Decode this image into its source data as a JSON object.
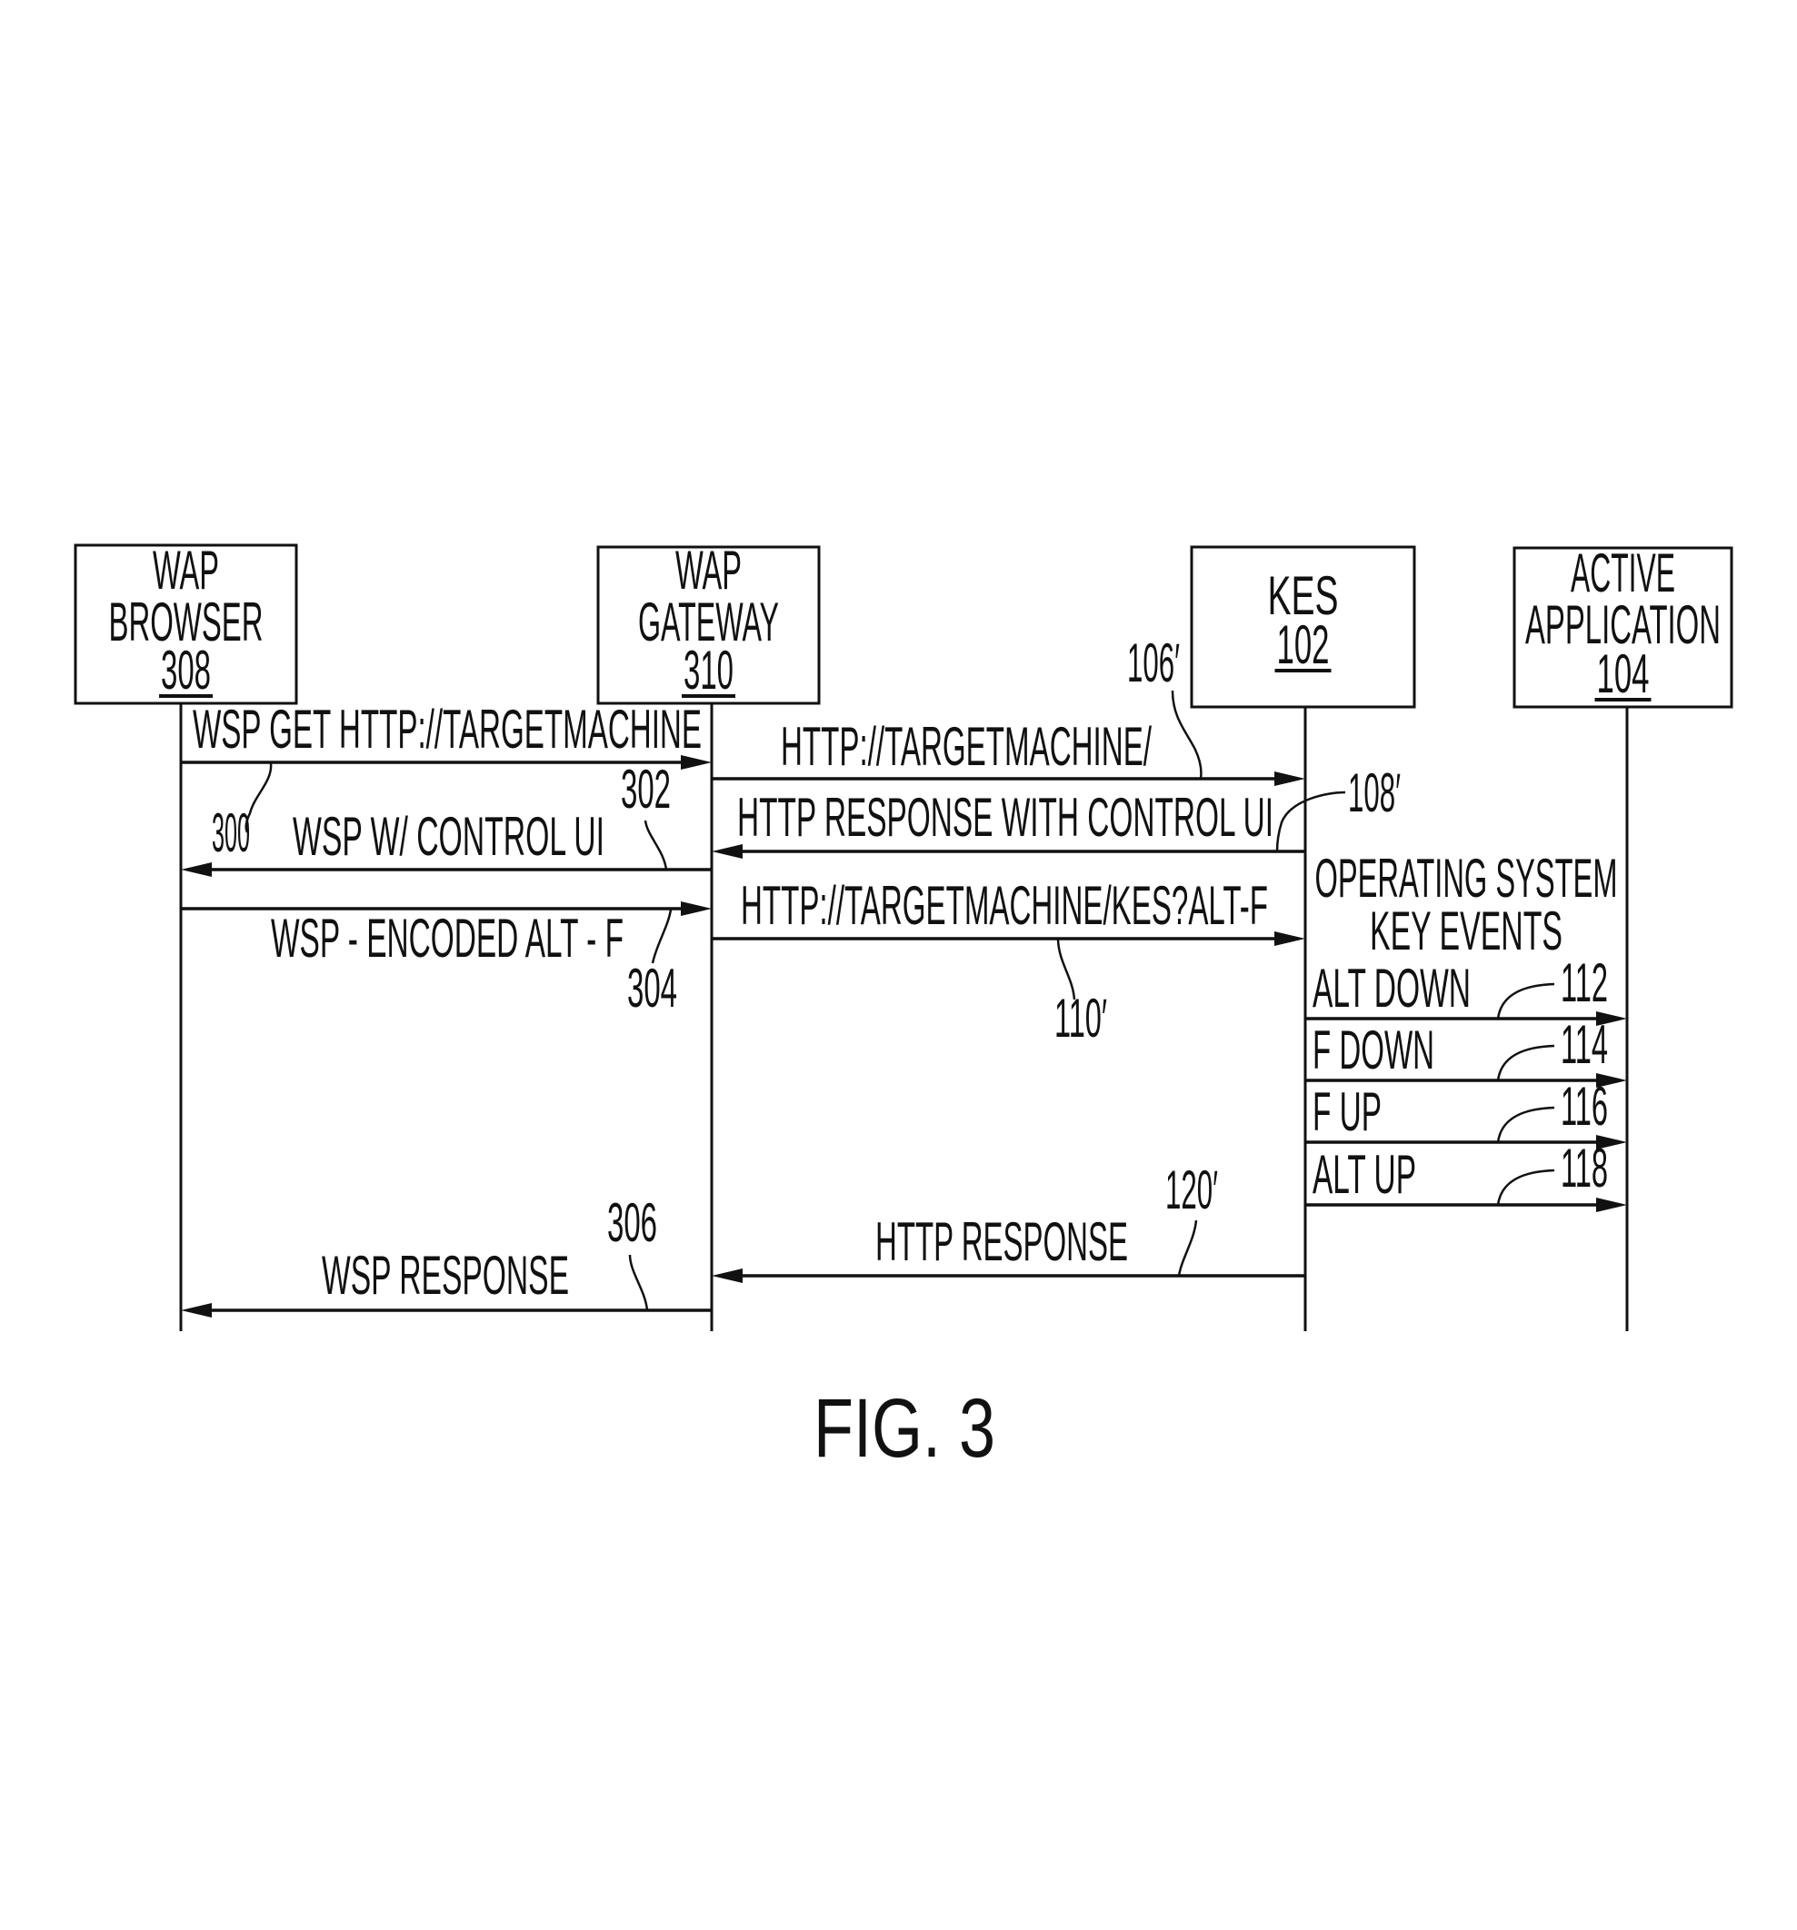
{
  "figure": {
    "caption": "FIG. 3"
  },
  "participants": [
    {
      "id": "browser",
      "lines": [
        "WAP",
        "BROWSER"
      ],
      "ref": "308"
    },
    {
      "id": "gateway",
      "lines": [
        "WAP",
        "GATEWAY"
      ],
      "ref": "310"
    },
    {
      "id": "kes",
      "lines": [
        "KES"
      ],
      "ref": "102"
    },
    {
      "id": "app",
      "lines": [
        "ACTIVE",
        "APPLICATION"
      ],
      "ref": "104"
    }
  ],
  "messages": [
    {
      "from": "browser",
      "to": "gateway",
      "label": "WSP GET HTTP://TARGETMACHINE",
      "ref": "300"
    },
    {
      "from": "gateway",
      "to": "kes",
      "label": "HTTP://TARGETMACHINE/",
      "ref": "106′"
    },
    {
      "from": "kes",
      "to": "gateway",
      "label": "HTTP RESPONSE WITH CONTROL UI",
      "ref": "108′"
    },
    {
      "from": "gateway",
      "to": "browser",
      "label": "WSP W/ CONTROL UI",
      "ref": "302"
    },
    {
      "from": "browser",
      "to": "gateway",
      "label": "WSP - ENCODED ALT - F",
      "ref": "304"
    },
    {
      "from": "gateway",
      "to": "kes",
      "label": "HTTP://TARGETMACHINE/KES?ALT-F",
      "ref": "110′"
    },
    {
      "from": "kes",
      "to": "app",
      "label": "ALT DOWN",
      "ref": "112"
    },
    {
      "from": "kes",
      "to": "app",
      "label": "F DOWN",
      "ref": "114"
    },
    {
      "from": "kes",
      "to": "app",
      "label": "F UP",
      "ref": "116"
    },
    {
      "from": "kes",
      "to": "app",
      "label": "ALT UP",
      "ref": "118"
    },
    {
      "from": "kes",
      "to": "gateway",
      "label": "HTTP RESPONSE",
      "ref": "120′"
    },
    {
      "from": "gateway",
      "to": "browser",
      "label": "WSP RESPONSE",
      "ref": "306"
    }
  ],
  "notes": [
    {
      "id": "os-key-events",
      "lines": [
        "OPERATING SYSTEM",
        "KEY EVENTS"
      ]
    }
  ]
}
